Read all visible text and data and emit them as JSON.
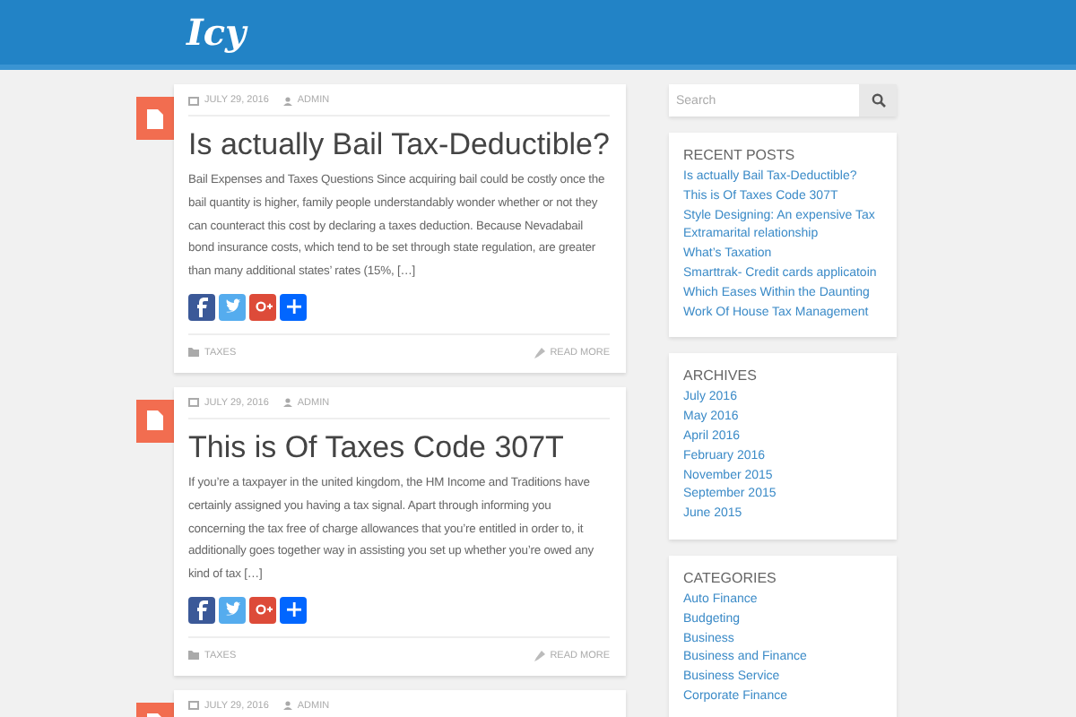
{
  "header": {
    "logo": "Icy"
  },
  "posts": [
    {
      "date": "JULY 29, 2016",
      "author": "ADMIN",
      "title": "Is actually Bail Tax-Deductible?",
      "excerpt": "Bail Expenses and Taxes Questions Since acquiring bail could be costly once the bail quantity is higher, family people understandably wonder whether or not they can counteract this cost by declaring a taxes deduction. Because Nevadabail bond insurance costs, which tend to be set through state regulation, are greater than many additional states’ rates (15%, […]",
      "category": "TAXES",
      "read_more": "READ MORE"
    },
    {
      "date": "JULY 29, 2016",
      "author": "ADMIN",
      "title": "This is Of Taxes Code 307T",
      "excerpt": "If you’re a taxpayer in the united kingdom, the HM Income and Traditions have certainly assigned you having a tax signal. Apart through informing you concerning the tax free of charge allowances that you’re entitled in order to, it additionally goes together way in assisting you set up whether you’re owed any kind of tax […]",
      "category": "TAXES",
      "read_more": "READ MORE"
    },
    {
      "date": "JULY 29, 2016",
      "author": "ADMIN"
    }
  ],
  "sidebar": {
    "search": {
      "placeholder": "Search"
    },
    "widgets": [
      {
        "title": "RECENT POSTS",
        "links": [
          "Is actually Bail Tax-Deductible?",
          "This is Of Taxes Code 307T",
          "Style Designing: An expensive Tax Extramarital relationship",
          "What’s Taxation",
          "Smarttrak- Credit cards applicatoin",
          "Which Eases Within the Daunting Work Of House Tax Management"
        ]
      },
      {
        "title": "ARCHIVES",
        "links": [
          "July 2016",
          "May 2016",
          "April 2016",
          "February 2016",
          "November 2015",
          "September 2015",
          "June 2015"
        ]
      },
      {
        "title": "CATEGORIES",
        "links": [
          "Auto Finance",
          "Budgeting",
          "Business",
          "Business and Finance",
          "Business Service",
          "Corporate Finance"
        ]
      }
    ]
  }
}
